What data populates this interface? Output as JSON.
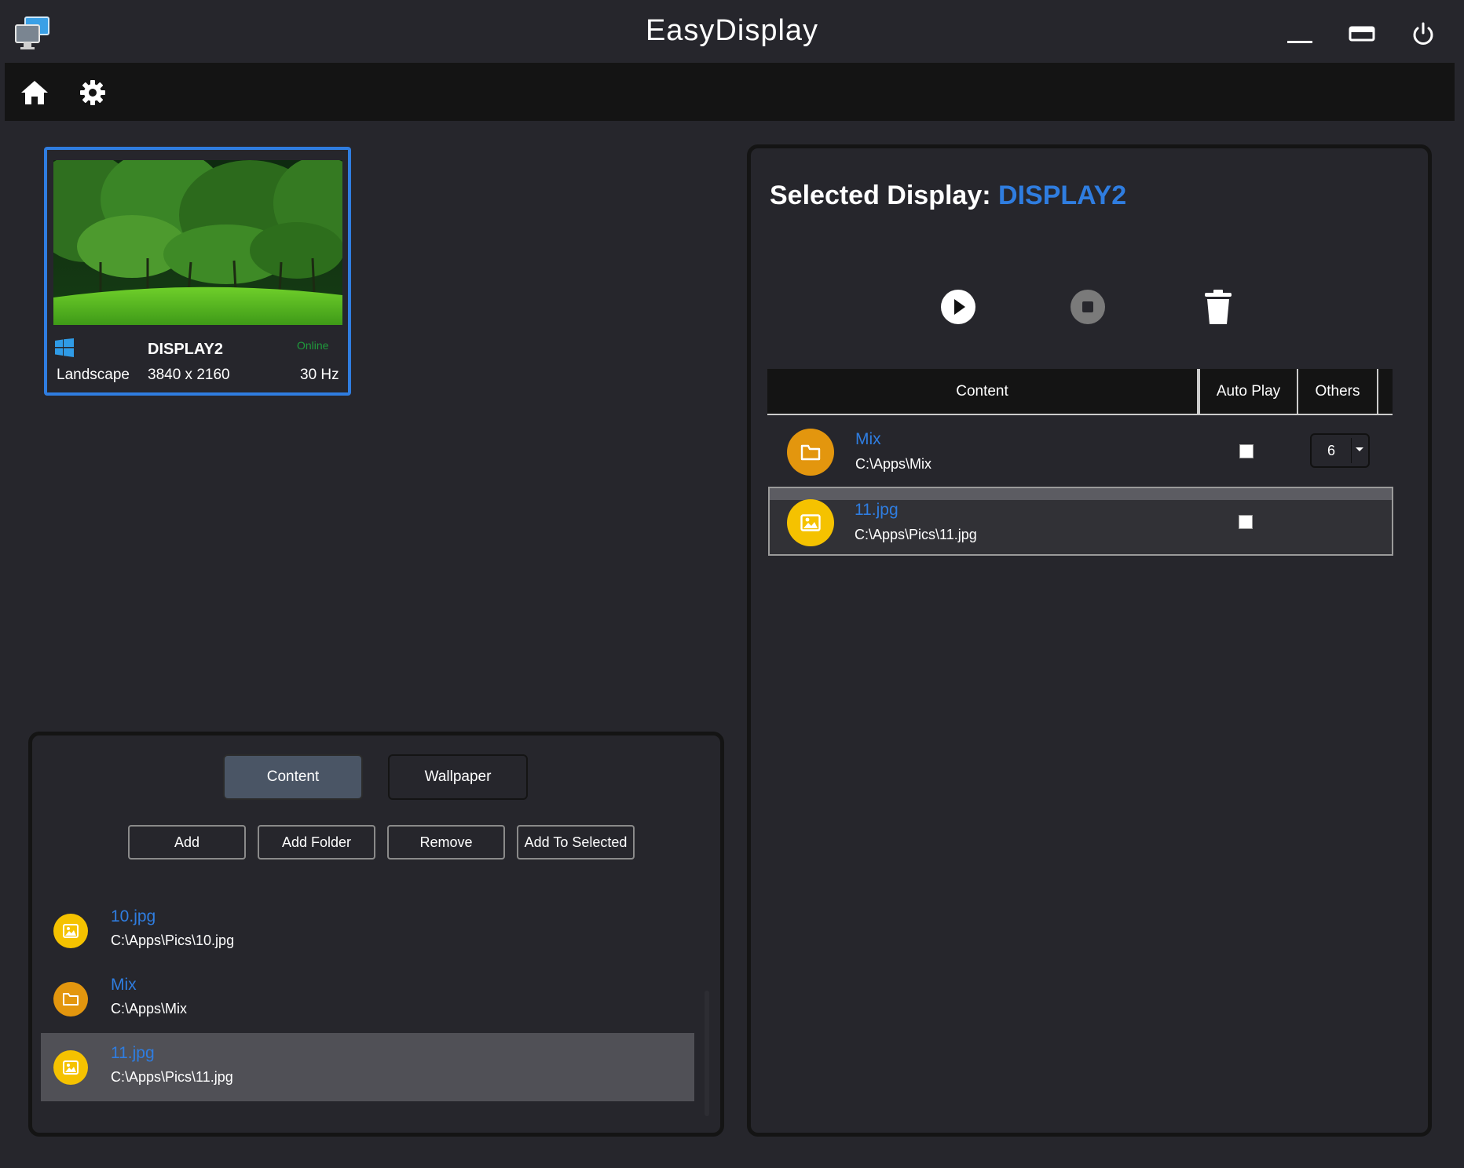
{
  "app": {
    "title": "EasyDisplay"
  },
  "display_card": {
    "name": "DISPLAY2",
    "status": "Online",
    "orientation": "Landscape",
    "resolution": "3840 x 2160",
    "refresh": "30 Hz"
  },
  "left_panel": {
    "tabs": [
      {
        "label": "Content",
        "active": true
      },
      {
        "label": "Wallpaper",
        "active": false
      }
    ],
    "actions": [
      "Add",
      "Add Folder",
      "Remove",
      "Add To Selected"
    ],
    "items": [
      {
        "name": "10.jpg",
        "path": "C:\\Apps\\Pics\\10.jpg",
        "type": "image-icon",
        "selected": false
      },
      {
        "name": "Mix",
        "path": "C:\\Apps\\Mix",
        "type": "folder-icon",
        "selected": false
      },
      {
        "name": "11.jpg",
        "path": "C:\\Apps\\Pics\\11.jpg",
        "type": "image-icon",
        "selected": true
      }
    ]
  },
  "right_panel": {
    "title_prefix": "Selected Display:",
    "title_display": "DISPLAY2",
    "columns": [
      "Content",
      "Auto Play",
      "Others"
    ],
    "rows": [
      {
        "name": "Mix",
        "path": "C:\\Apps\\Mix",
        "type": "folder-icon",
        "auto_play": false,
        "others": "6"
      },
      {
        "name": "11.jpg",
        "path": "C:\\Apps\\Pics\\11.jpg",
        "type": "image-icon",
        "auto_play": false,
        "others": ""
      }
    ]
  },
  "colors": {
    "accent": "#2f7de0",
    "folder": "#e3960e",
    "image": "#f5c200",
    "online": "#1f9a3c"
  }
}
